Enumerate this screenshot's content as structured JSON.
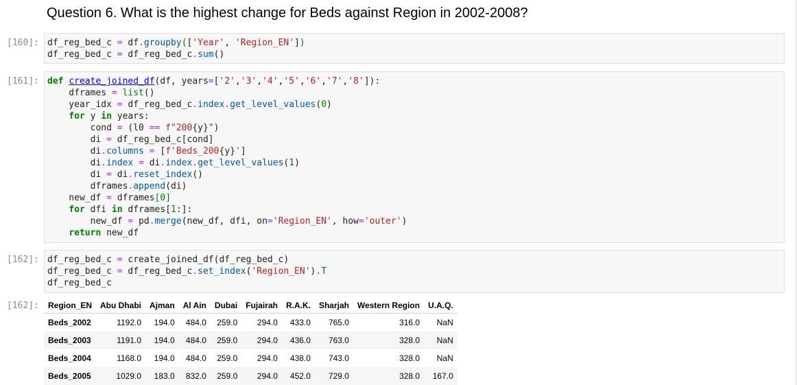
{
  "heading": "Question 6. What is the highest change for Beds against Region in 2002-2008?",
  "cells": [
    {
      "prompt": "[160]:"
    },
    {
      "prompt": "[161]:"
    },
    {
      "prompt": "[162]:"
    },
    {
      "prompt": "[162]:"
    }
  ],
  "table": {
    "columns": [
      "Region_EN",
      "Abu Dhabi",
      "Ajman",
      "Al Ain",
      "Dubai",
      "Fujairah",
      "R.A.K.",
      "Sharjah",
      "Western Region",
      "U.A.Q."
    ],
    "rows": [
      {
        "label": "Beds_2002",
        "values": [
          "1192.0",
          "194.0",
          "484.0",
          "259.0",
          "294.0",
          "433.0",
          "765.0",
          "316.0",
          "NaN"
        ]
      },
      {
        "label": "Beds_2003",
        "values": [
          "1191.0",
          "194.0",
          "484.0",
          "259.0",
          "294.0",
          "436.0",
          "763.0",
          "328.0",
          "NaN"
        ]
      },
      {
        "label": "Beds_2004",
        "values": [
          "1168.0",
          "194.0",
          "484.0",
          "259.0",
          "294.0",
          "438.0",
          "743.0",
          "328.0",
          "NaN"
        ]
      },
      {
        "label": "Beds_2005",
        "values": [
          "1029.0",
          "183.0",
          "832.0",
          "259.0",
          "294.0",
          "452.0",
          "729.0",
          "328.0",
          "167.0"
        ]
      }
    ]
  }
}
